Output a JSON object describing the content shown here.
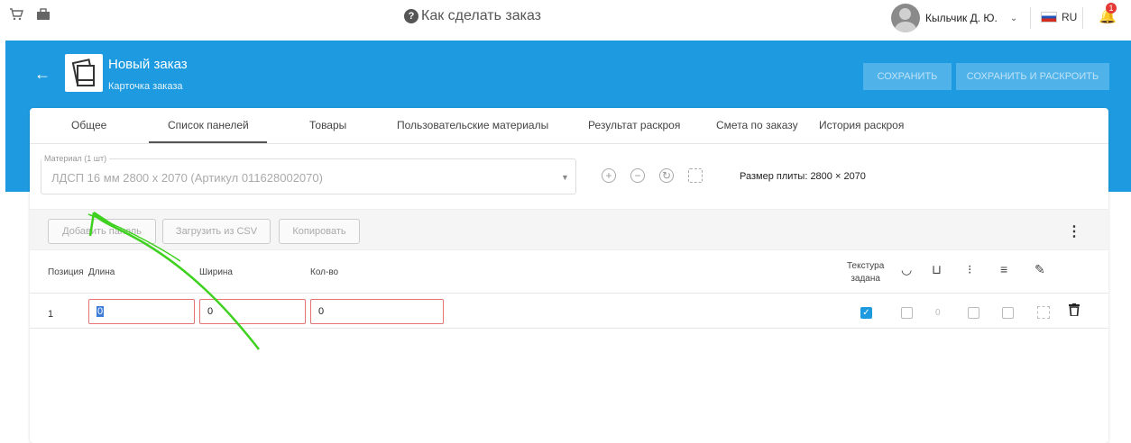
{
  "topbar": {
    "cart_icon": "cart-icon",
    "briefcase_icon": "briefcase-icon",
    "help_text": "Как сделать заказ",
    "user_name": "Кыльчик Д. Ю.",
    "lang": "RU",
    "notif_count": "1"
  },
  "header": {
    "title": "Новый заказ",
    "subtitle": "Карточка заказа",
    "save_label": "СОХРАНИТЬ",
    "save_cut_label": "СОХРАНИТЬ И РАСКРОИТЬ"
  },
  "tabs": [
    {
      "label": "Общее"
    },
    {
      "label": "Список панелей",
      "active": true
    },
    {
      "label": "Товары"
    },
    {
      "label": "Пользовательские материалы"
    },
    {
      "label": "Результат раскроя"
    },
    {
      "label": "Смета по заказу"
    },
    {
      "label": "История раскроя"
    }
  ],
  "material": {
    "label": "Материал (1 шт)",
    "value": "ЛДСП 16 мм 2800 x 2070 (Артикул 011628002070)",
    "plate_size": "Размер плиты: 2800 × 2070"
  },
  "toolbar": {
    "add_panel": "Добавить панель",
    "load_csv": "Загрузить из CSV",
    "copy": "Копировать"
  },
  "table": {
    "headers": {
      "position": "Позиция",
      "length": "Длина",
      "width": "Ширина",
      "qty": "Кол-во",
      "texture_1": "Текстура",
      "texture_2": "задана"
    },
    "rows": [
      {
        "position": "1",
        "length": "0",
        "width": "0",
        "qty": "0",
        "texture": true,
        "edge_count": "0"
      }
    ]
  },
  "colors": {
    "accent": "#1e9be0",
    "error_border": "#e57373",
    "annotation": "#3fd11f"
  }
}
